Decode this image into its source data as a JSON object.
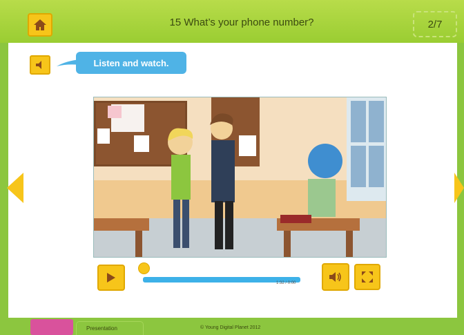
{
  "header": {
    "title": "15 What’s your phone number?",
    "page_counter": "2/7"
  },
  "instruction": {
    "text": "Listen and watch."
  },
  "player": {
    "current_time": "1:32",
    "separator": "/",
    "total_time": "0:00",
    "progress_fraction": 0.0
  },
  "footer": {
    "tab_label": "Presentation",
    "copyright": "© Young Digital Planet 2012"
  },
  "colors": {
    "brand_green": "#8cc63f",
    "accent_yellow": "#f7c51a",
    "bubble_blue": "#4fb3e6",
    "progress_blue": "#3db1e8"
  },
  "icons": {
    "home": "home-icon",
    "speaker": "speaker-icon",
    "prev": "arrow-left-icon",
    "next": "arrow-right-icon",
    "play": "play-icon",
    "volume": "volume-icon",
    "fullscreen": "fullscreen-icon"
  }
}
